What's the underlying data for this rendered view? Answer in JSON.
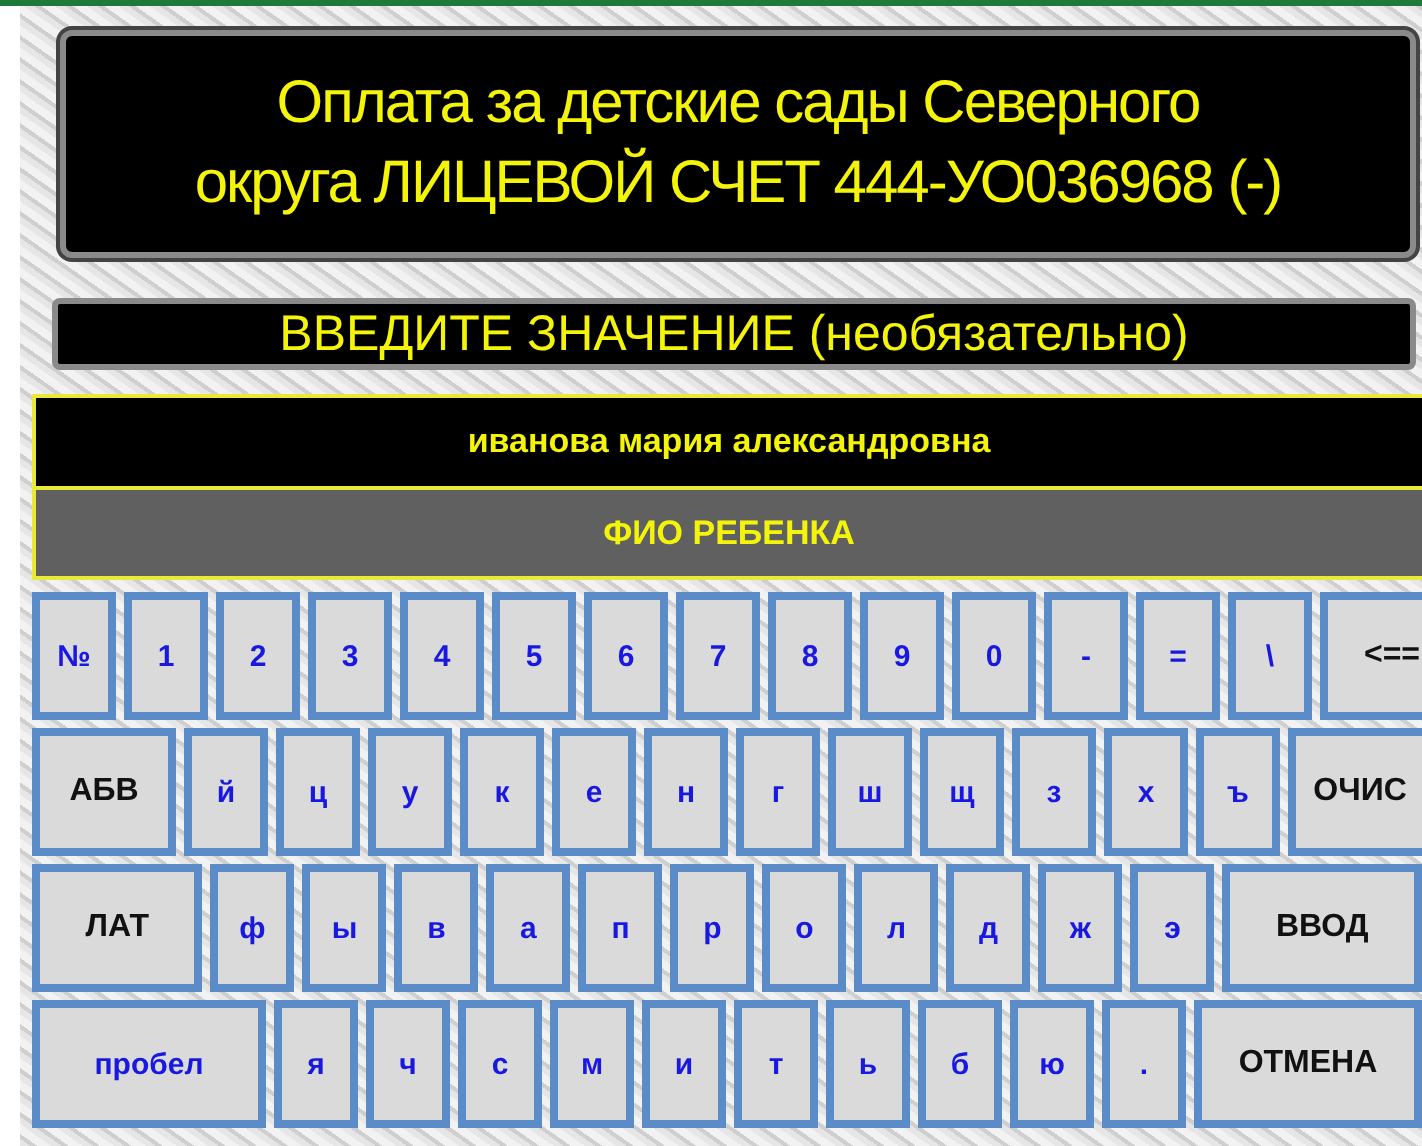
{
  "title": [
    "Оплата за детские сады Северного",
    "округа ЛИЦЕВОЙ СЧЕТ 444-УО036968 (-)"
  ],
  "prompt": "ВВЕДИТЕ ЗНАЧЕНИЕ (необязательно)",
  "field": {
    "value": "иванова мария александровна",
    "label": "ФИО РЕБЕНКА"
  },
  "keyboard": [
    [
      {
        "label": "№",
        "kind": "char"
      },
      {
        "label": "1",
        "kind": "char"
      },
      {
        "label": "2",
        "kind": "char"
      },
      {
        "label": "3",
        "kind": "char"
      },
      {
        "label": "4",
        "kind": "char"
      },
      {
        "label": "5",
        "kind": "char"
      },
      {
        "label": "6",
        "kind": "char"
      },
      {
        "label": "7",
        "kind": "char"
      },
      {
        "label": "8",
        "kind": "char"
      },
      {
        "label": "9",
        "kind": "char"
      },
      {
        "label": "0",
        "kind": "char"
      },
      {
        "label": "-",
        "kind": "char"
      },
      {
        "label": "=",
        "kind": "char"
      },
      {
        "label": "\\",
        "kind": "char"
      },
      {
        "label": "<==",
        "kind": "command"
      }
    ],
    [
      {
        "label": "АБВ",
        "kind": "command"
      },
      {
        "label": "й",
        "kind": "char"
      },
      {
        "label": "ц",
        "kind": "char"
      },
      {
        "label": "у",
        "kind": "char"
      },
      {
        "label": "к",
        "kind": "char"
      },
      {
        "label": "е",
        "kind": "char"
      },
      {
        "label": "н",
        "kind": "char"
      },
      {
        "label": "г",
        "kind": "char"
      },
      {
        "label": "ш",
        "kind": "char"
      },
      {
        "label": "щ",
        "kind": "char"
      },
      {
        "label": "з",
        "kind": "char"
      },
      {
        "label": "х",
        "kind": "char"
      },
      {
        "label": "ъ",
        "kind": "char"
      },
      {
        "label": "ОЧИС",
        "kind": "command"
      }
    ],
    [
      {
        "label": "ЛАТ",
        "kind": "command"
      },
      {
        "label": "ф",
        "kind": "char"
      },
      {
        "label": "ы",
        "kind": "char"
      },
      {
        "label": "в",
        "kind": "char"
      },
      {
        "label": "а",
        "kind": "char"
      },
      {
        "label": "п",
        "kind": "char"
      },
      {
        "label": "р",
        "kind": "char"
      },
      {
        "label": "о",
        "kind": "char"
      },
      {
        "label": "л",
        "kind": "char"
      },
      {
        "label": "д",
        "kind": "char"
      },
      {
        "label": "ж",
        "kind": "char"
      },
      {
        "label": "э",
        "kind": "char"
      },
      {
        "label": "ВВОД",
        "kind": "command"
      }
    ],
    [
      {
        "label": "пробел",
        "kind": "space"
      },
      {
        "label": "я",
        "kind": "char"
      },
      {
        "label": "ч",
        "kind": "char"
      },
      {
        "label": "с",
        "kind": "char"
      },
      {
        "label": "м",
        "kind": "char"
      },
      {
        "label": "и",
        "kind": "char"
      },
      {
        "label": "т",
        "kind": "char"
      },
      {
        "label": "ь",
        "kind": "char"
      },
      {
        "label": "б",
        "kind": "char"
      },
      {
        "label": "ю",
        "kind": "char"
      },
      {
        "label": ".",
        "kind": "char"
      },
      {
        "label": "ОТМЕНА",
        "kind": "command"
      }
    ]
  ]
}
